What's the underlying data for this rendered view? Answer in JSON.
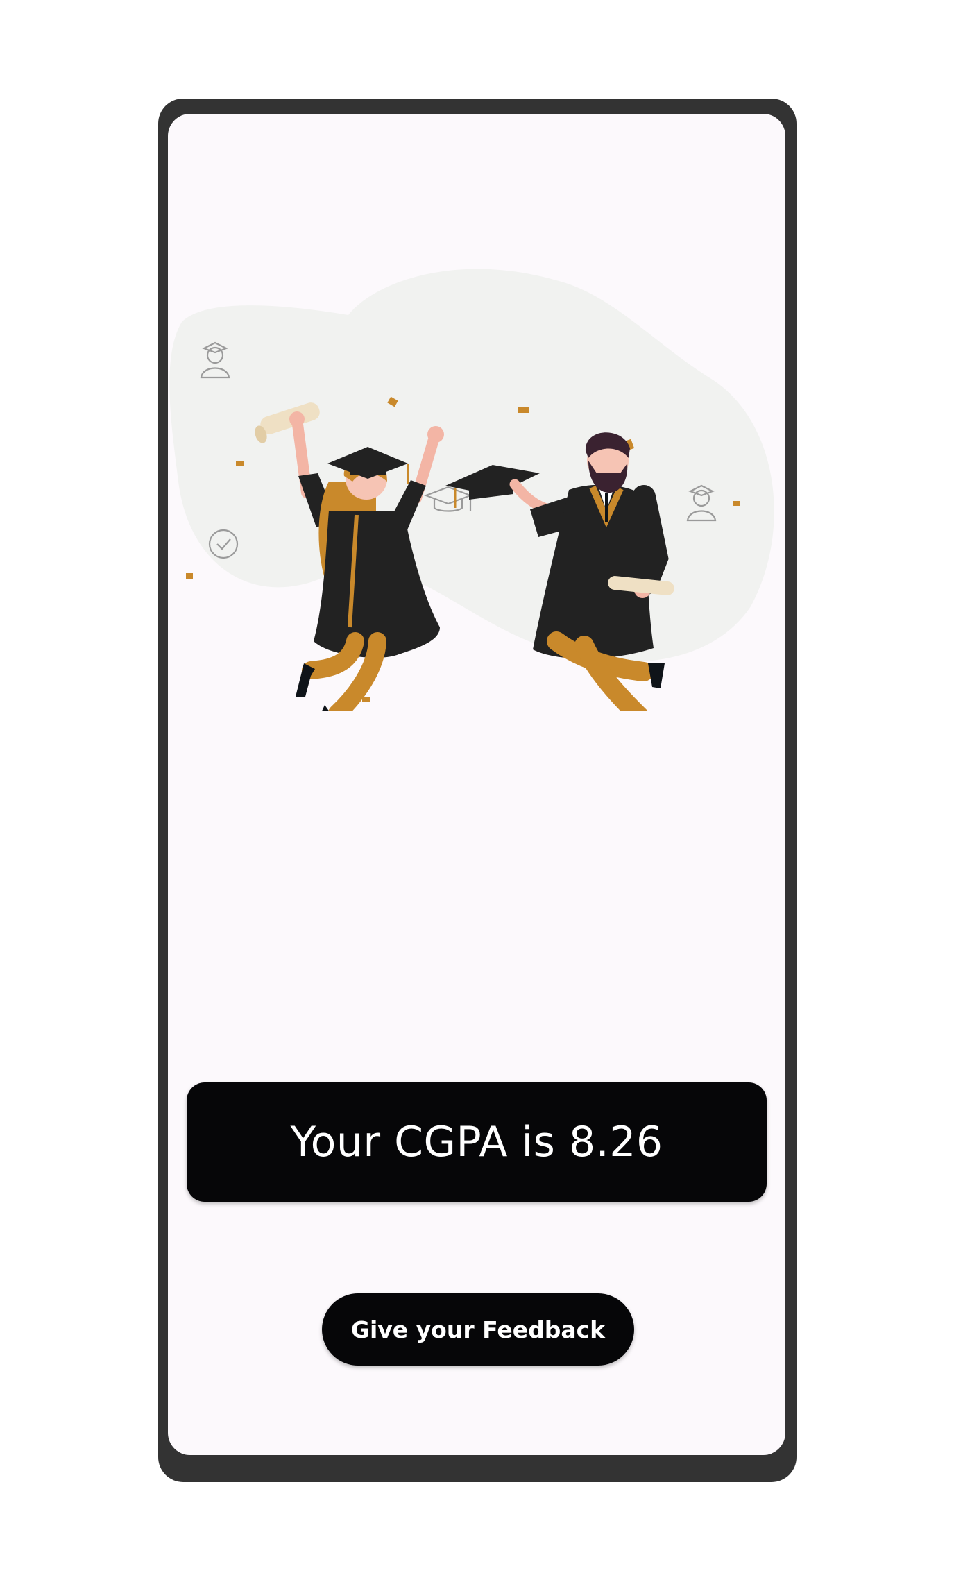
{
  "result": {
    "cgpa_text": "Your CGPA is 8.26"
  },
  "actions": {
    "feedback_label": "Give your Feedback"
  },
  "illustration": {
    "icons": [
      "scroll-icon",
      "graduation-cap-icon",
      "graduate-avatar-icon",
      "verified-badge-icon"
    ]
  },
  "colors": {
    "frame": "#333333",
    "screen_background": "#fcf9fc",
    "card_background": "#060608",
    "card_text": "#ffffff",
    "gown": "#222222",
    "accent_gold": "#c9892b",
    "blob": "#f1f2f0"
  }
}
